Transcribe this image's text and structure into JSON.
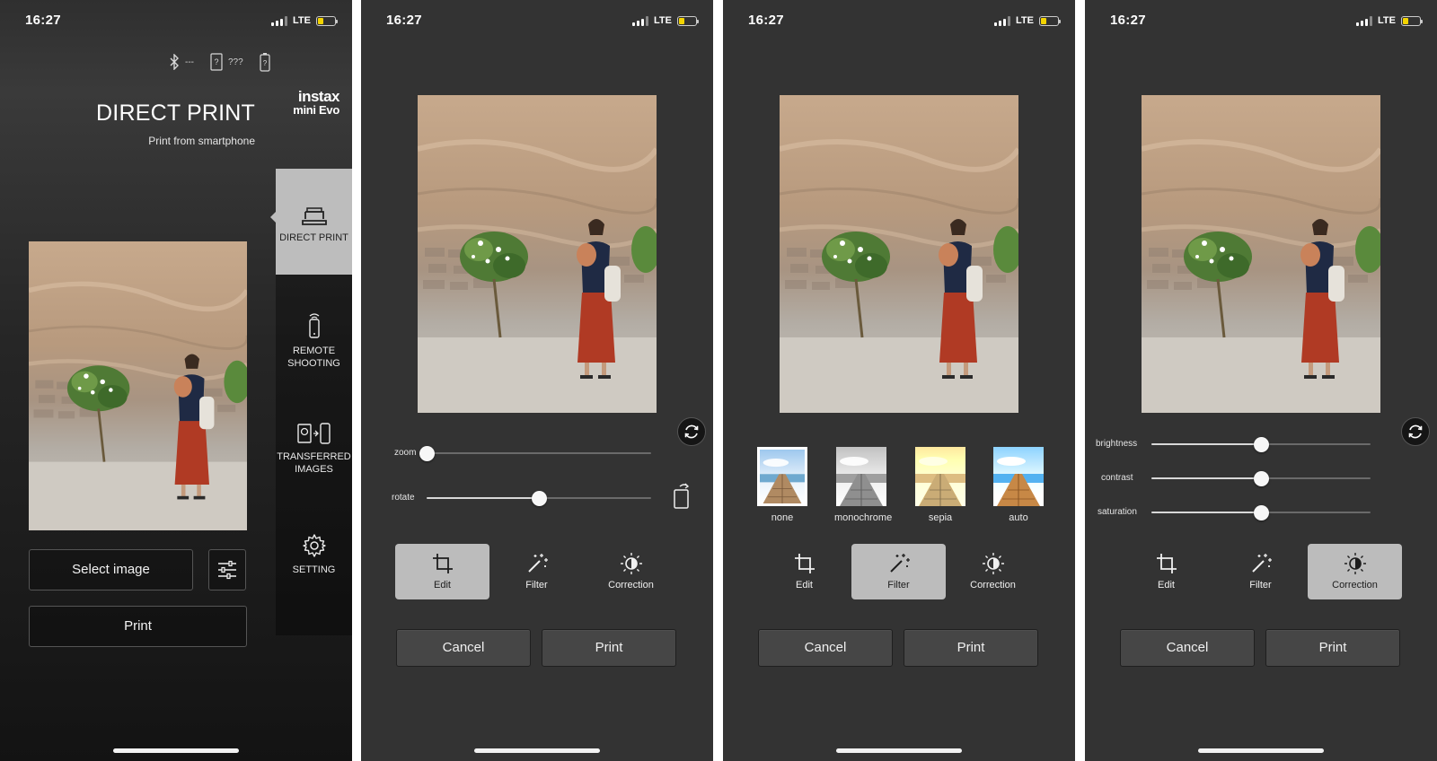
{
  "status": {
    "time": "16:27",
    "network": "LTE"
  },
  "screen1": {
    "connection": {
      "bt_status": "---",
      "device_status": "???"
    },
    "title": "DIRECT PRINT",
    "subtitle": "Print from smartphone",
    "brand": {
      "line1": "instax",
      "line2": "mini Evo"
    },
    "menu": [
      {
        "label": "DIRECT PRINT",
        "icon": "printer-icon",
        "active": true
      },
      {
        "line1": "REMOTE",
        "line2": "SHOOTING",
        "icon": "remote-phone-icon"
      },
      {
        "line1": "TRANSFERRED",
        "line2": "IMAGES",
        "icon": "transfer-icon"
      },
      {
        "label": "SETTING",
        "icon": "gear-icon"
      }
    ],
    "select_image": "Select image",
    "print": "Print"
  },
  "screen2": {
    "sliders": [
      {
        "label": "zoom",
        "value": 0.0
      },
      {
        "label": "rotate",
        "value": 0.5
      }
    ]
  },
  "screen3": {
    "filters": [
      {
        "label": "none",
        "selected": true
      },
      {
        "label": "monochrome"
      },
      {
        "label": "sepia"
      },
      {
        "label": "auto"
      }
    ]
  },
  "screen4": {
    "sliders": [
      {
        "label": "brightness",
        "value": 0.5
      },
      {
        "label": "contrast",
        "value": 0.5
      },
      {
        "label": "saturation",
        "value": 0.5
      }
    ]
  },
  "tools": {
    "edit": "Edit",
    "filter": "Filter",
    "correction": "Correction"
  },
  "buttons": {
    "cancel": "Cancel",
    "print": "Print"
  },
  "colors": {
    "background": "#333333",
    "active_tab": "#bcbcbc",
    "battery": "#f3d400"
  }
}
